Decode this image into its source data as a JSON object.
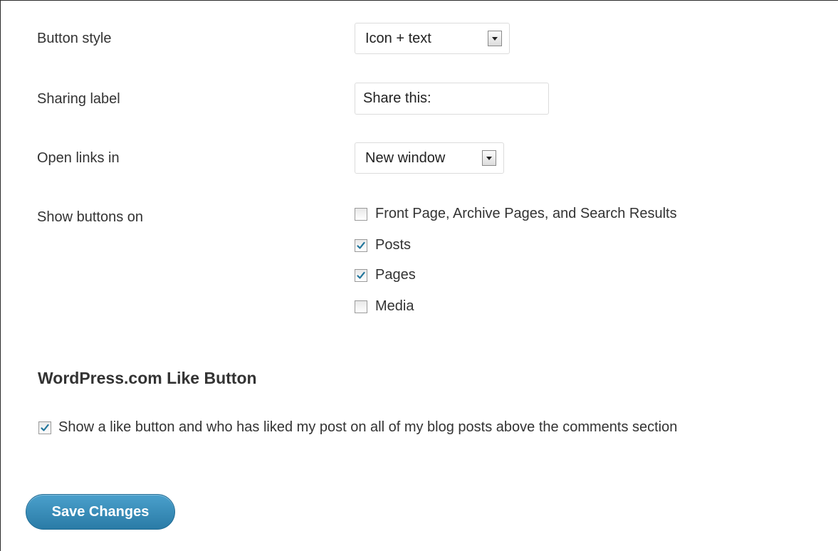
{
  "settings": {
    "button_style": {
      "label": "Button style",
      "value": "Icon + text"
    },
    "sharing_label": {
      "label": "Sharing label",
      "value": "Share this:"
    },
    "open_links": {
      "label": "Open links in",
      "value": "New window"
    },
    "show_buttons": {
      "label": "Show buttons on",
      "options": [
        {
          "label": "Front Page, Archive Pages, and Search Results",
          "checked": false
        },
        {
          "label": "Posts",
          "checked": true
        },
        {
          "label": "Pages",
          "checked": true
        },
        {
          "label": "Media",
          "checked": false
        }
      ]
    }
  },
  "like_section": {
    "heading": "WordPress.com Like Button",
    "option": {
      "label": "Show a like button and who has liked my post on all of my blog posts above the comments section",
      "checked": true
    }
  },
  "save_label": "Save Changes",
  "colors": {
    "accent": "#2a7ba6",
    "check": "#21759b"
  }
}
